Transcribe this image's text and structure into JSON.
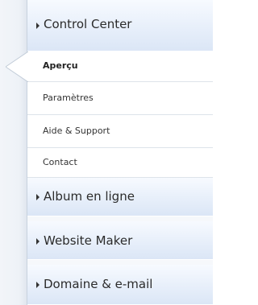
{
  "nav": {
    "sections": [
      {
        "label": "Control Center"
      },
      {
        "label": "Album en ligne"
      },
      {
        "label": "Website Maker"
      },
      {
        "label": "Domaine & e-mail"
      }
    ],
    "control_center_items": [
      {
        "label": "Aperçu",
        "active": true
      },
      {
        "label": "Paramètres"
      },
      {
        "label": "Aide & Support"
      },
      {
        "label": "Contact"
      }
    ]
  },
  "colors": {
    "section_gradient_top": "#f7faff",
    "section_gradient_bottom": "#dbe6f6",
    "text": "#2b2b2b",
    "divider": "#dde3ea"
  },
  "icons": {
    "expand_arrow": "triangle-right-icon",
    "active_pointer": "active-pointer-icon"
  }
}
